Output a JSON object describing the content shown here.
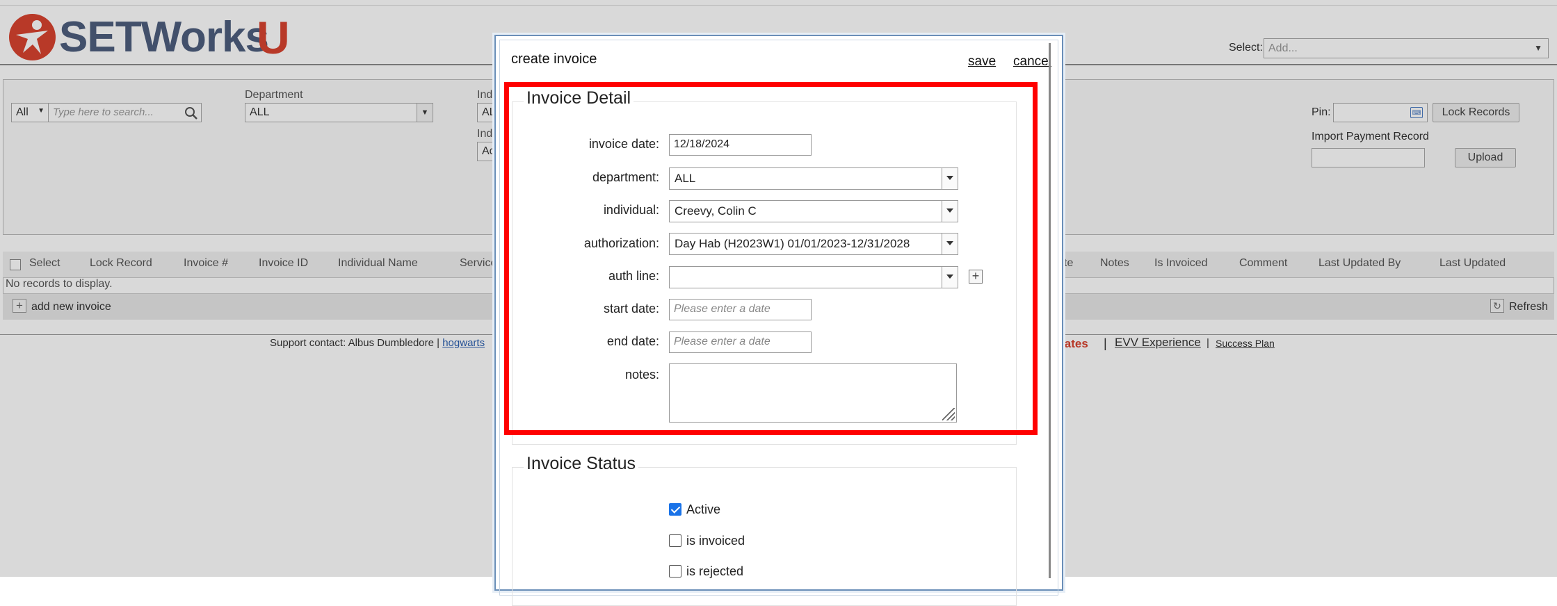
{
  "brand": {
    "logo_text": "SETWorks",
    "logo_u": "U"
  },
  "header": {
    "select_label": "Select:",
    "select_placeholder": "Add..."
  },
  "filters": {
    "scope_value": "All",
    "search_placeholder": "Type here to search...",
    "department_label": "Department",
    "department_value": "ALL",
    "indiv_label_1": "Indi",
    "indiv_value_1": "AL",
    "indiv_label_2": "Indi",
    "indiv_value_2": "Ac",
    "pin_label": "Pin:",
    "lock_records_label": "Lock Records",
    "import_label": "Import Payment Record",
    "upload_label": "Upload"
  },
  "grid": {
    "columns_left": [
      "Select",
      "Lock Record",
      "Invoice #",
      "Invoice ID",
      "Individual Name",
      "Service"
    ],
    "columns_right": [
      "te",
      "Notes",
      "Is Invoiced",
      "Comment",
      "Last Updated By",
      "Last Updated"
    ],
    "no_records": "No records to display.",
    "add_label": "add new invoice",
    "refresh_label": "Refresh"
  },
  "footer": {
    "support_text": "Support contact: Albus Dumbledore | ",
    "support_link": "hogwarts",
    "updates": "pdates",
    "sep": "|",
    "evv": "EVV Experience",
    "sep2": "|",
    "success": "Success Plan"
  },
  "modal": {
    "title": "create invoice",
    "save_label": "save",
    "cancel_label": "cancel",
    "detail_legend": "Invoice Detail",
    "fields": {
      "invoice_date_label": "invoice date:",
      "invoice_date_value": "12/18/2024",
      "department_label": "department:",
      "department_value": "ALL",
      "individual_label": "individual:",
      "individual_value": "Creevy, Colin C",
      "authorization_label": "authorization:",
      "authorization_value": "Day Hab (H2023W1) 01/01/2023-12/31/2028",
      "auth_line_label": "auth line:",
      "auth_line_value": "",
      "start_date_label": "start date:",
      "start_date_placeholder": "Please enter a date",
      "end_date_label": "end date:",
      "end_date_placeholder": "Please enter a date",
      "notes_label": "notes:"
    },
    "status_legend": "Invoice Status",
    "status": [
      {
        "label": "Active",
        "checked": true
      },
      {
        "label": "is invoiced",
        "checked": false
      },
      {
        "label": "is rejected",
        "checked": false
      }
    ]
  },
  "colors": {
    "highlight": "#ff0000",
    "brand_red": "#d9432f",
    "brand_blue": "#4e5f7e",
    "checkbox_blue": "#1a73e8"
  }
}
